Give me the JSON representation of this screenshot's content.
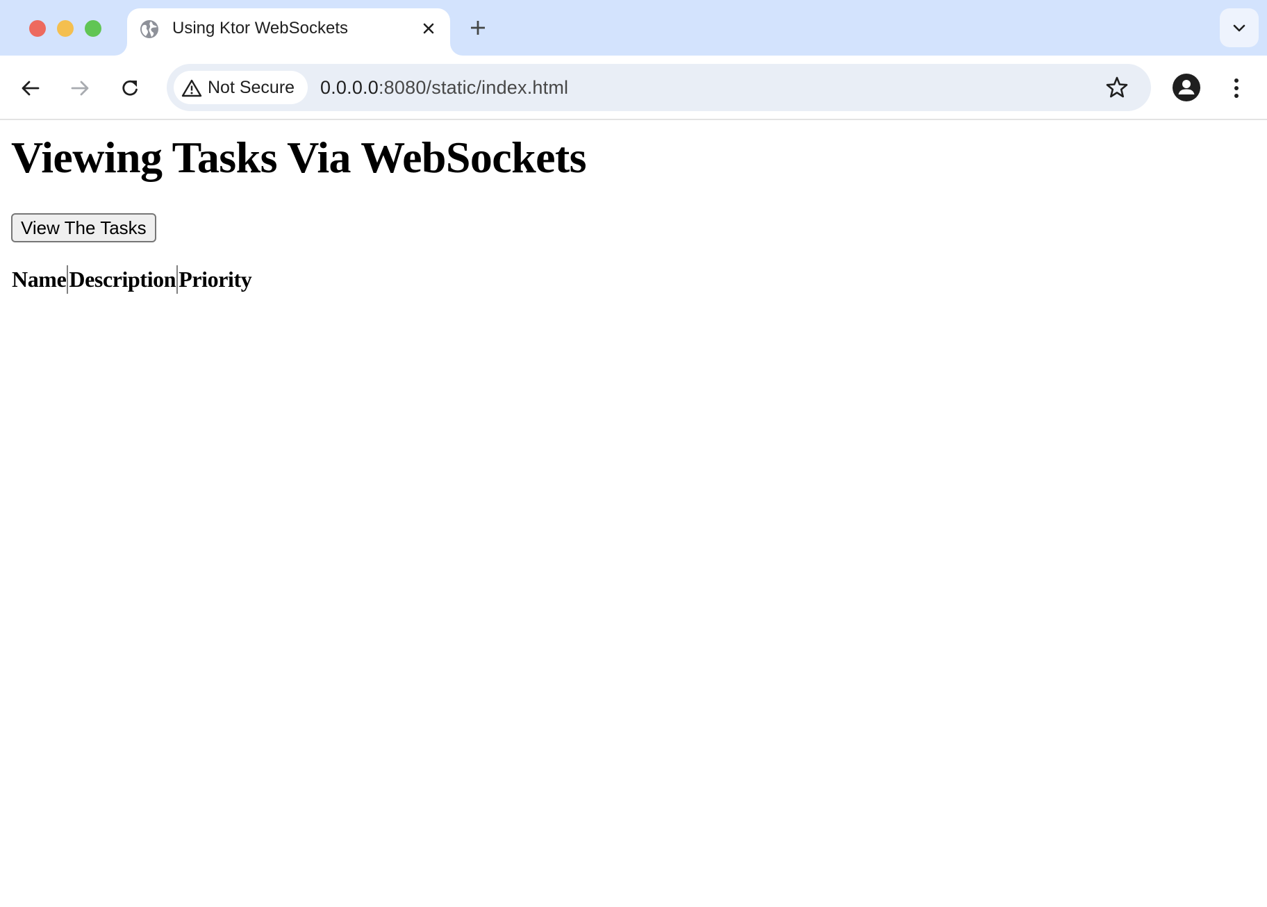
{
  "browser": {
    "window_controls": [
      "close",
      "minimize",
      "maximize"
    ],
    "tab": {
      "title": "Using Ktor WebSockets",
      "favicon": "globe-icon",
      "close_icon": "close-icon"
    },
    "new_tab_icon": "plus-icon",
    "tab_search_icon": "chevron-down-icon",
    "toolbar": {
      "back_icon": "arrow-left-icon",
      "forward_icon": "arrow-right-icon",
      "reload_icon": "reload-icon",
      "security_chip": {
        "icon": "warning-triangle-icon",
        "label": "Not Secure"
      },
      "url": {
        "host": "0.0.0.0",
        "path": ":8080/static/index.html"
      },
      "bookmark_icon": "star-icon",
      "profile_icon": "account-circle-icon",
      "menu_icon": "kebab-menu-icon"
    },
    "colors": {
      "tabstrip_bg": "#d3e3fd",
      "omnibox_bg": "#e9eef6",
      "traffic_red": "#ed6a5e",
      "traffic_yellow": "#f4bf4f",
      "traffic_green": "#61c554"
    }
  },
  "page": {
    "heading": "Viewing Tasks Via WebSockets",
    "view_button_label": "View The Tasks",
    "table": {
      "columns": [
        "Name",
        "Description",
        "Priority"
      ],
      "rows": []
    }
  }
}
